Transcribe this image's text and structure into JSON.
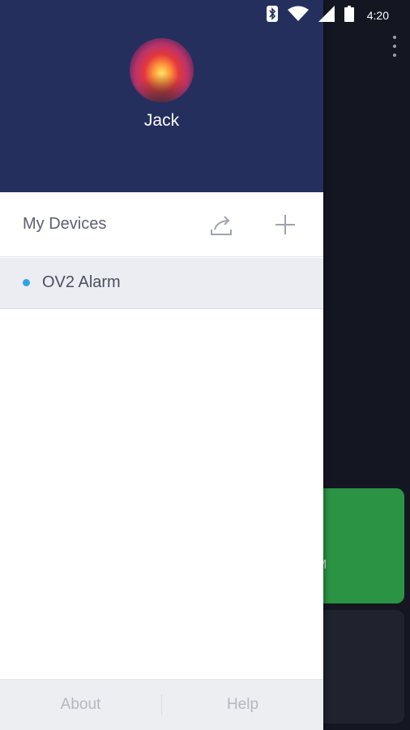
{
  "status_bar": {
    "time": "4:20",
    "icons": [
      "bluetooth-icon",
      "wifi-icon",
      "cell-signal-icon",
      "battery-icon"
    ]
  },
  "background_app": {
    "menu_icon": "overflow-menu-icon",
    "green_card_text": "M",
    "accent_green": "#2a9444"
  },
  "drawer": {
    "header_color": "#252f5e",
    "user": {
      "name": "Jack"
    },
    "devices_section": {
      "title": "My Devices",
      "share_icon": "share-icon",
      "add_icon": "plus-icon"
    },
    "devices": [
      {
        "name": "OV2 Alarm",
        "status_color": "#2fa3e6"
      }
    ],
    "footer": {
      "about_label": "About",
      "help_label": "Help"
    }
  }
}
